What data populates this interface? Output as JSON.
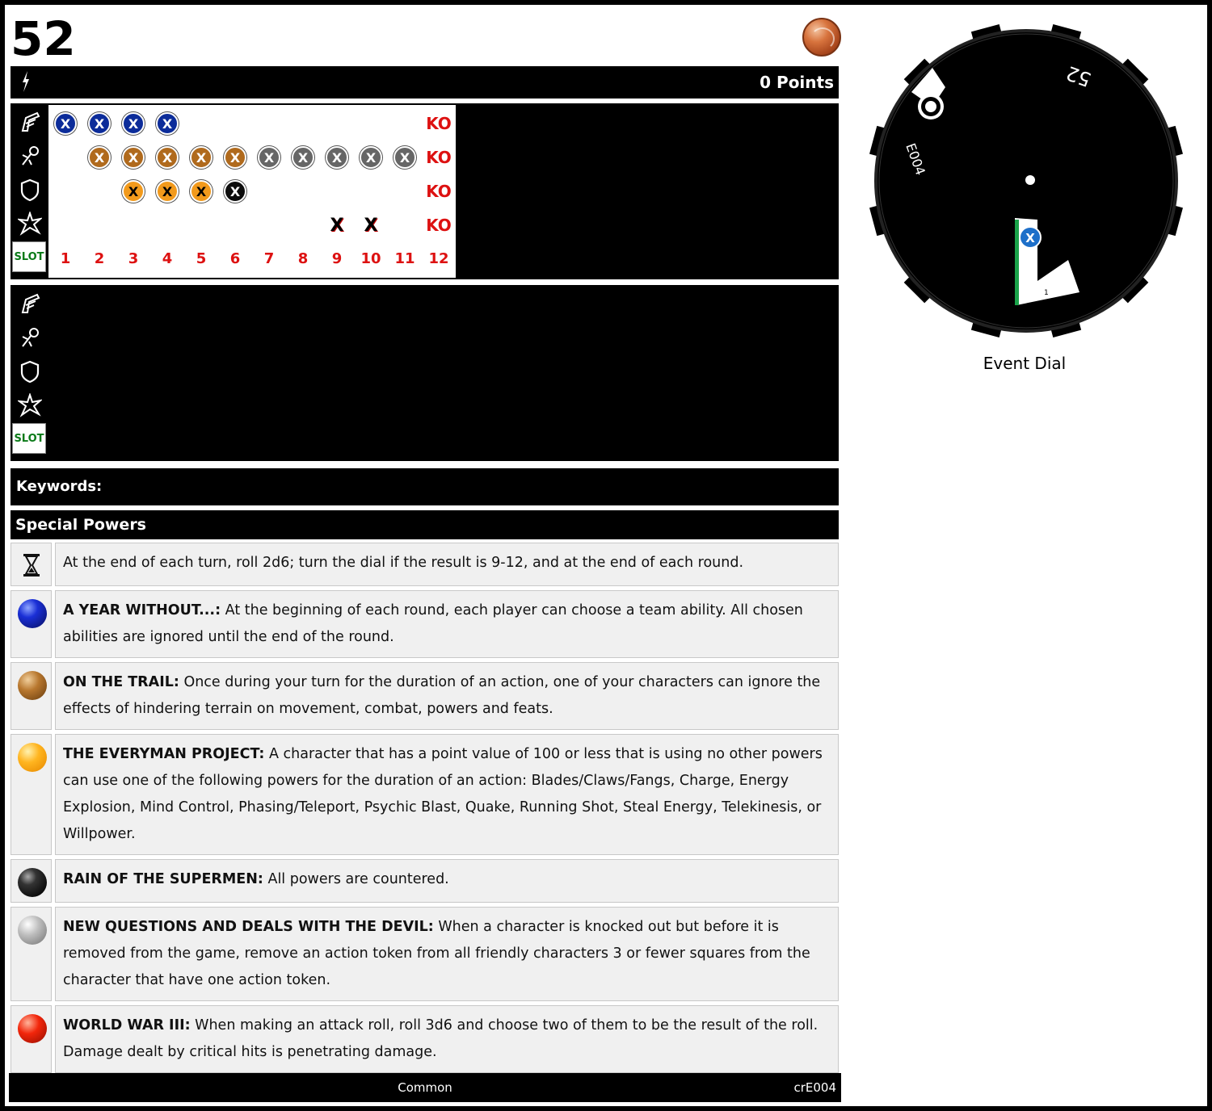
{
  "header": {
    "title": "52",
    "badge_icon": "globe-icon",
    "points": "0 Points",
    "action_icon": "lightning-bolt-icon"
  },
  "stat_icons": [
    "speed-icon",
    "attack-icon",
    "defense-icon",
    "damage-icon"
  ],
  "slot_label": "SLOT",
  "dial_rows": [
    {
      "stat": "speed",
      "tokens": [
        {
          "slot": 1,
          "text": "X",
          "color": "blue"
        },
        {
          "slot": 2,
          "text": "X",
          "color": "blue"
        },
        {
          "slot": 3,
          "text": "X",
          "color": "blue"
        },
        {
          "slot": 4,
          "text": "X",
          "color": "blue"
        }
      ]
    },
    {
      "stat": "attack",
      "tokens": [
        {
          "slot": 2,
          "text": "X",
          "color": "bronze"
        },
        {
          "slot": 3,
          "text": "X",
          "color": "bronze"
        },
        {
          "slot": 4,
          "text": "X",
          "color": "bronze"
        },
        {
          "slot": 5,
          "text": "X",
          "color": "bronze"
        },
        {
          "slot": 6,
          "text": "X",
          "color": "bronze"
        },
        {
          "slot": 7,
          "text": "X",
          "color": "gray"
        },
        {
          "slot": 8,
          "text": "X",
          "color": "gray"
        },
        {
          "slot": 9,
          "text": "X",
          "color": "gray"
        },
        {
          "slot": 10,
          "text": "X",
          "color": "gray"
        },
        {
          "slot": 11,
          "text": "X",
          "color": "gray"
        }
      ]
    },
    {
      "stat": "defense",
      "tokens": [
        {
          "slot": 3,
          "text": "X",
          "color": "orange"
        },
        {
          "slot": 4,
          "text": "X",
          "color": "orange"
        },
        {
          "slot": 5,
          "text": "X",
          "color": "orange"
        },
        {
          "slot": 6,
          "text": "X",
          "color": "black"
        }
      ]
    },
    {
      "stat": "damage",
      "tokens": [
        {
          "slot": 9,
          "text": "X",
          "color": "plain"
        },
        {
          "slot": 10,
          "text": "X",
          "color": "plain"
        }
      ]
    }
  ],
  "ko_label": "KO",
  "slot_numbers": [
    "1",
    "2",
    "3",
    "4",
    "5",
    "6",
    "7",
    "8",
    "9",
    "10",
    "11",
    "12"
  ],
  "keywords_label": "Keywords:",
  "special_powers_title": "Special Powers",
  "powers": [
    {
      "icon": "hourglass-icon",
      "color": "hourglass",
      "name": "",
      "text": "At the end of each turn, roll 2d6; turn the dial if the result is 9-12, and at the end of each round."
    },
    {
      "icon": "blue-ball-icon",
      "color": "blue",
      "name": "A YEAR WITHOUT...:",
      "text": " At the beginning of each round, each player can choose a team ability. All chosen abilities are ignored until the end of the round."
    },
    {
      "icon": "bronze-ball-icon",
      "color": "bronze",
      "name": "ON THE TRAIL:",
      "text": " Once during your turn for the duration of an action, one of your characters can ignore the effects of hindering terrain on movement, combat, powers and feats."
    },
    {
      "icon": "orange-ball-icon",
      "color": "orange",
      "name": "THE EVERYMAN PROJECT:",
      "text": " A character that has a point value of 100 or less that is using no other powers can use one of the following powers for the duration of an action: Blades/Claws/Fangs, Charge, Energy Explosion, Mind Control, Phasing/Teleport, Psychic Blast, Quake, Running Shot, Steal Energy, Telekinesis, or Willpower."
    },
    {
      "icon": "black-ball-icon",
      "color": "black",
      "name": "RAIN OF THE SUPERMEN:",
      "text": " All powers are countered."
    },
    {
      "icon": "gray-ball-icon",
      "color": "gray",
      "name": "NEW QUESTIONS AND DEALS WITH THE DEVIL:",
      "text": " When a character is knocked out but before it is removed from the game, remove an action token from all friendly characters 3 or fewer squares from the character that have one action token."
    },
    {
      "icon": "red-ball-icon",
      "color": "red",
      "name": "WORLD WAR III:",
      "text": " When making an attack roll, roll 3d6 and choose two of them to be the result of the roll. Damage dealt by critical hits is penetrating damage."
    }
  ],
  "footer": {
    "rarity": "Common",
    "code": "crE004"
  },
  "dial": {
    "label": "Event Dial",
    "rim_text": "52",
    "code_text": "E004",
    "token_text": "X",
    "slot_marker": "1"
  }
}
